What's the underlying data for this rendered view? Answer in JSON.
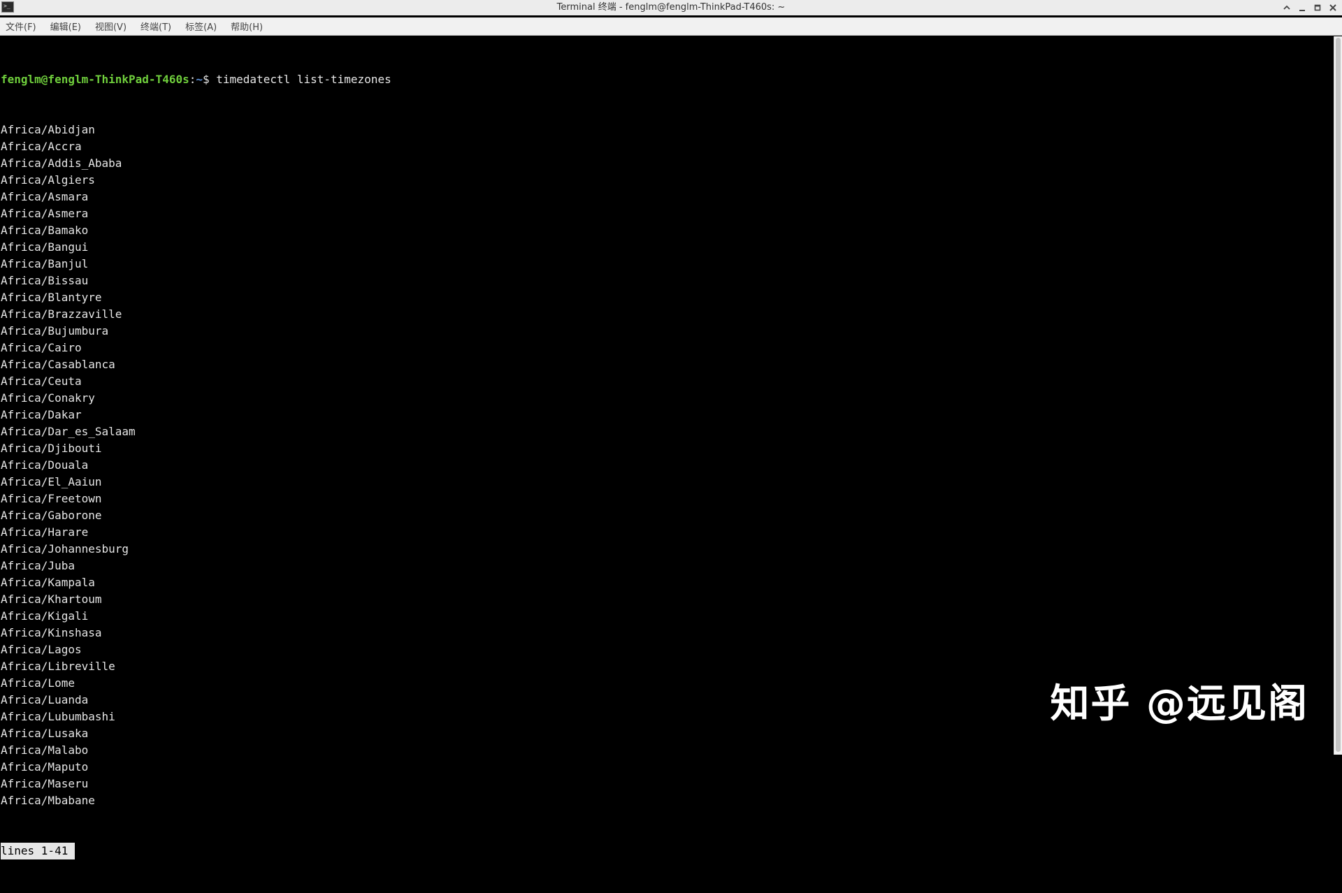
{
  "window": {
    "title": "Terminal 终端 - fenglm@fenglm-ThinkPad-T460s: ~"
  },
  "menu": {
    "items": [
      "文件(F)",
      "编辑(E)",
      "视图(V)",
      "终端(T)",
      "标签(A)",
      "帮助(H)"
    ]
  },
  "terminal": {
    "prompt_user": "fenglm@fenglm-ThinkPad-T460s",
    "prompt_sep": ":",
    "prompt_path": "~",
    "prompt_symbol": "$ ",
    "command": "timedatectl list-timezones",
    "lines": [
      "Africa/Abidjan",
      "Africa/Accra",
      "Africa/Addis_Ababa",
      "Africa/Algiers",
      "Africa/Asmara",
      "Africa/Asmera",
      "Africa/Bamako",
      "Africa/Bangui",
      "Africa/Banjul",
      "Africa/Bissau",
      "Africa/Blantyre",
      "Africa/Brazzaville",
      "Africa/Bujumbura",
      "Africa/Cairo",
      "Africa/Casablanca",
      "Africa/Ceuta",
      "Africa/Conakry",
      "Africa/Dakar",
      "Africa/Dar_es_Salaam",
      "Africa/Djibouti",
      "Africa/Douala",
      "Africa/El_Aaiun",
      "Africa/Freetown",
      "Africa/Gaborone",
      "Africa/Harare",
      "Africa/Johannesburg",
      "Africa/Juba",
      "Africa/Kampala",
      "Africa/Khartoum",
      "Africa/Kigali",
      "Africa/Kinshasa",
      "Africa/Lagos",
      "Africa/Libreville",
      "Africa/Lome",
      "Africa/Luanda",
      "Africa/Lubumbashi",
      "Africa/Lusaka",
      "Africa/Malabo",
      "Africa/Maputo",
      "Africa/Maseru",
      "Africa/Mbabane"
    ],
    "pager_status": "lines 1-41"
  },
  "watermark": {
    "text": "知乎 @远见阁"
  },
  "icons": {
    "app": "terminal-icon",
    "controls": [
      "chevron-up-icon",
      "minimize-icon",
      "maximize-icon",
      "close-icon"
    ]
  }
}
